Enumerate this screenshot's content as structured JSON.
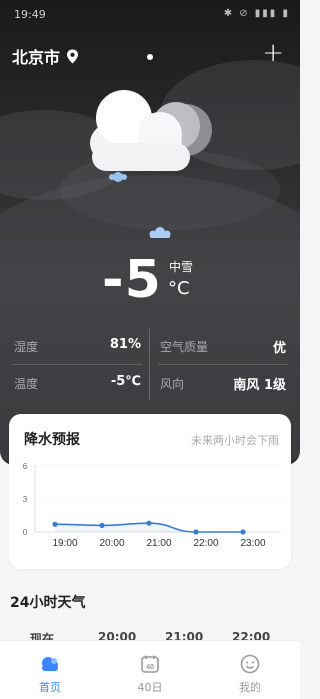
{
  "status_bar": {
    "time": "19:49",
    "icons": "✱ ⊘ ▮▮▮ ▮"
  },
  "location": {
    "city": "北京市",
    "icon": "location-pin-icon"
  },
  "actions": {
    "add_label": "+"
  },
  "current": {
    "temperature": "-5",
    "condition": "中雪",
    "unit": "°C",
    "weather_icon": "snow-cloud-icon"
  },
  "stats": {
    "humidity_label": "湿度",
    "humidity_value": "81%",
    "air_label": "空气质量",
    "air_value": "优",
    "temp_label": "温度",
    "temp_value": "-5℃",
    "wind_label": "风向",
    "wind_value": "南风 1级"
  },
  "precipitation": {
    "title": "降水预报",
    "hint": "未来两小时会下雨",
    "chart_data": {
      "type": "line",
      "x": [
        "19:00",
        "20:00",
        "21:00",
        "22:00",
        "23:00"
      ],
      "series": [
        {
          "values": [
            0.7,
            0.6,
            0.8,
            0,
            0
          ]
        }
      ],
      "yticks": [
        "6",
        "3",
        "0"
      ],
      "ylim": [
        0,
        6
      ],
      "color": "#3a7bd5"
    }
  },
  "hourly": {
    "title": "24小时天气",
    "items": [
      "现在",
      "20:00",
      "21:00",
      "22:00"
    ]
  },
  "nav": {
    "items": [
      {
        "label": "首页",
        "icon": "home-cloud-icon",
        "active": true
      },
      {
        "label": "40日",
        "icon": "calendar-40-icon",
        "active": false
      },
      {
        "label": "我的",
        "icon": "smiley-face-icon",
        "active": false
      }
    ]
  },
  "colors": {
    "accent": "#3a86ff",
    "hero_bg": "#2c2c2e",
    "line": "#3a7bd5"
  }
}
